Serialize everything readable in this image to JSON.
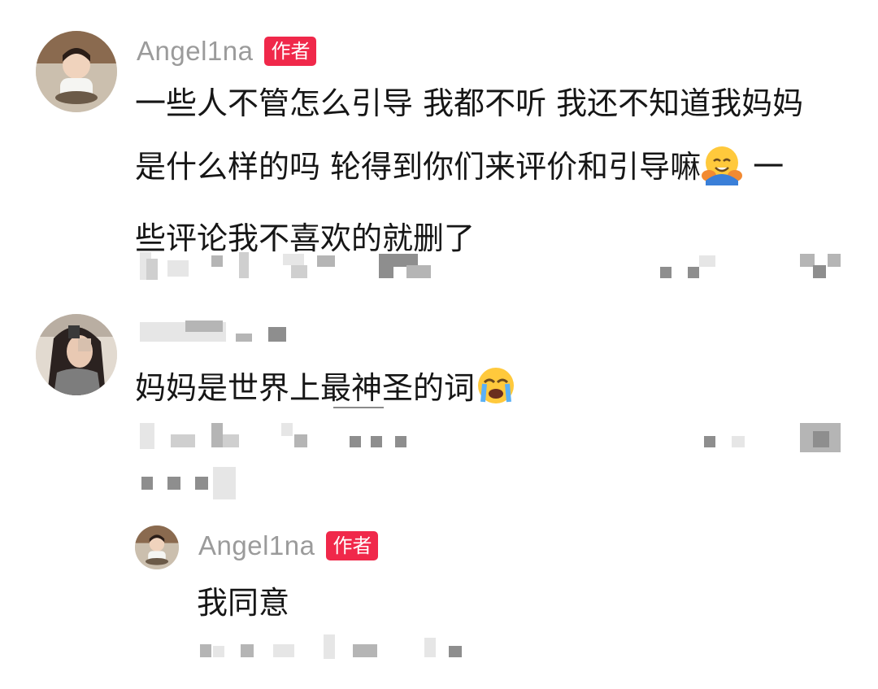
{
  "comments": [
    {
      "username": "Angel1na",
      "badge": "作者",
      "lines": [
        "一些人不管怎么引导 我都不听 我还不知道我妈妈",
        "是什么样的吗 轮得到你们来评价和引导嘛",
        "些评论我不喜欢的就删了"
      ],
      "line2_tail": " 一",
      "emoji": "hugging-face-icon"
    },
    {
      "username": "",
      "text": "妈妈是世界上最神圣的词",
      "emoji": "loudly-crying-face-icon"
    },
    {
      "username": "Angel1na",
      "badge": "作者",
      "text": "我同意"
    }
  ],
  "colors": {
    "badge": "#f0284a",
    "username": "#9b9b9b",
    "text": "#161616"
  }
}
